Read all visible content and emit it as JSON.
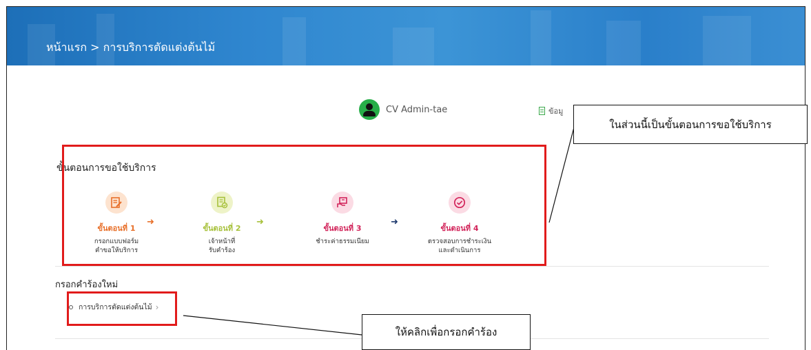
{
  "header": {
    "breadcrumb": "หน้าแรก > การบริการตัดแต่งต้นไม้"
  },
  "user": {
    "name": "CV Admin-tae",
    "info_label": "ข้อมู"
  },
  "steps_section": {
    "title": "ขั้นตอนการขอใช้บริการ",
    "steps": [
      {
        "label": "ขั้นตอนที่ 1",
        "desc_line1": "กรอกแบบฟอร์ม",
        "desc_line2": "คำขอให้บริการ",
        "color": "#e8702a",
        "bg": "#fde3cf",
        "icon": "form-edit-icon"
      },
      {
        "label": "ขั้นตอนที่ 2",
        "desc_line1": "เจ้าหน้าที่",
        "desc_line2": "รับคำร้อง",
        "color": "#a7c13b",
        "bg": "#eef3c8",
        "icon": "document-check-icon"
      },
      {
        "label": "ขั้นตอนที่ 3",
        "desc_line1": "ชำระค่าธรรมเนียม",
        "desc_line2": "",
        "color": "#d2245a",
        "bg": "#fbdbe4",
        "icon": "payment-hand-icon"
      },
      {
        "label": "ขั้นตอนที่ 4",
        "desc_line1": "ตรวจสอบการชำระเงิน",
        "desc_line2": "และดำเนินการ",
        "color": "#d2245a",
        "bg": "#fbdbe4",
        "icon": "check-circle-icon"
      }
    ],
    "arrow_colors": [
      "#e8702a",
      "#a7c13b",
      "#1e3a6e"
    ]
  },
  "new_request": {
    "title": "กรอกคำร้องใหม่",
    "service_link": "การบริการตัดแต่งต้นไม้",
    "chevron": "›"
  },
  "annotations": {
    "steps_note": "ในส่วนนี้เป็นขั้นตอนการขอใช้บริการ",
    "click_note": "ให้คลิกเพื่อกรอกคำร้อง"
  },
  "colors": {
    "highlight": "#e11b1b",
    "banner": "#2f86cf",
    "avatar": "#27ae48"
  }
}
